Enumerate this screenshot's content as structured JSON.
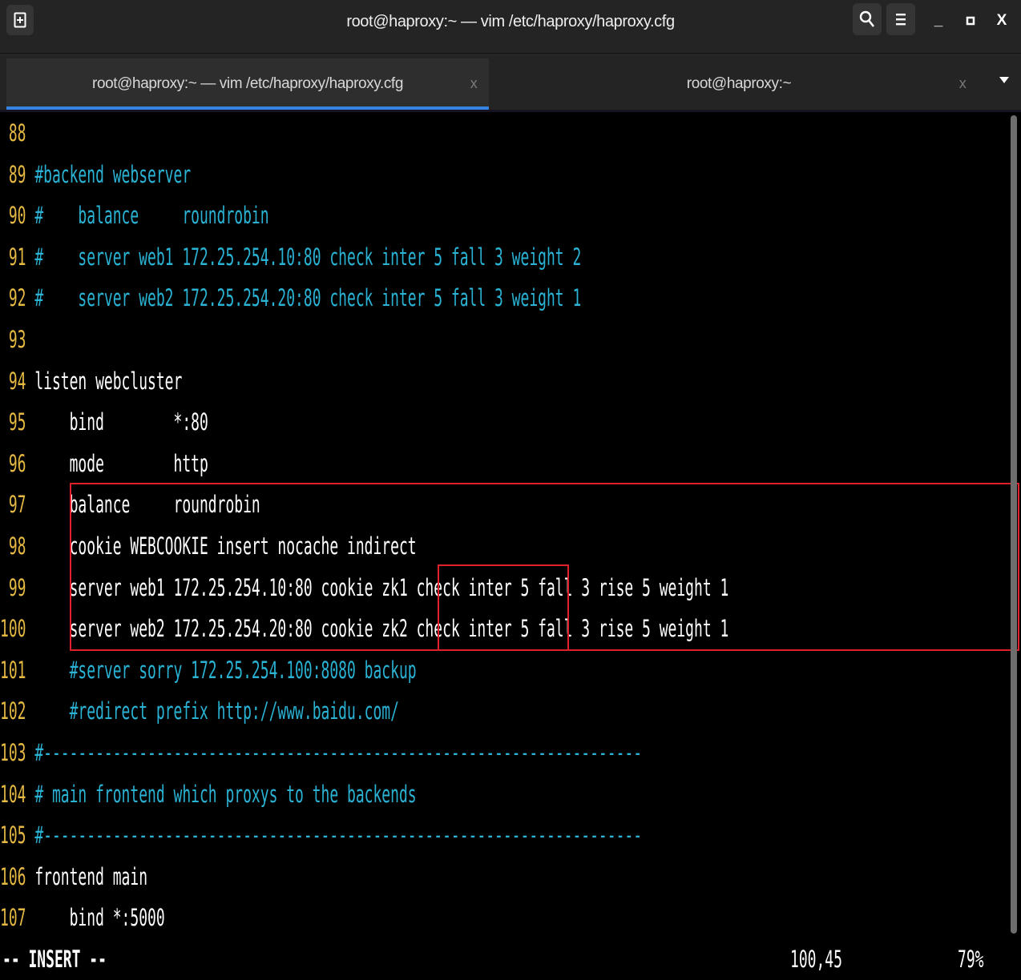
{
  "window": {
    "title": "root@haproxy:~ — vim /etc/haproxy/haproxy.cfg",
    "buttons": {
      "new_tab_icon": "new-tab-icon",
      "search_icon": "search-icon",
      "menu_icon": "hamburger-menu-icon",
      "minimize": "_",
      "maximize": "▫",
      "close": "X"
    }
  },
  "tabs": [
    {
      "label": "root@haproxy:~ — vim /etc/haproxy/haproxy.cfg",
      "close": "x",
      "active": true
    },
    {
      "label": "root@haproxy:~",
      "close": "x",
      "active": false
    }
  ],
  "editor": {
    "lines": [
      {
        "num": " 88",
        "text": "",
        "comment": false
      },
      {
        "num": " 89",
        "text": "#backend webserver",
        "comment": true
      },
      {
        "num": " 90",
        "text": "#    balance     roundrobin",
        "comment": true
      },
      {
        "num": " 91",
        "text": "#    server web1 172.25.254.10:80 check inter 5 fall 3 weight 2",
        "comment": true
      },
      {
        "num": " 92",
        "text": "#    server web2 172.25.254.20:80 check inter 5 fall 3 weight 1",
        "comment": true
      },
      {
        "num": " 93",
        "text": "",
        "comment": false
      },
      {
        "num": " 94",
        "text": "listen webcluster",
        "comment": false
      },
      {
        "num": " 95",
        "text": "    bind        *:80",
        "comment": false
      },
      {
        "num": " 96",
        "text": "    mode        http",
        "comment": false
      },
      {
        "num": " 97",
        "text": "    balance     roundrobin",
        "comment": false
      },
      {
        "num": " 98",
        "text": "    cookie WEBCOOKIE insert nocache indirect",
        "comment": false
      },
      {
        "num": " 99",
        "text": "    server web1 172.25.254.10:80 cookie zk1 check inter 5 fall 3 rise 5 weight 1",
        "comment": false
      },
      {
        "num": "100",
        "text": "    server web2 172.25.254.20:80 cookie zk2 check inter 5 fall 3 rise 5 weight 1",
        "comment": false
      },
      {
        "num": "101",
        "text": "    #server sorry 172.25.254.100:8080 backup",
        "comment": true
      },
      {
        "num": "102",
        "text": "    #redirect prefix http://www.baidu.com/",
        "comment": true
      },
      {
        "num": "103",
        "text": "#---------------------------------------------------------------------",
        "comment": true
      },
      {
        "num": "104",
        "text": "# main frontend which proxys to the backends",
        "comment": true
      },
      {
        "num": "105",
        "text": "#---------------------------------------------------------------------",
        "comment": true
      },
      {
        "num": "106",
        "text": "frontend main",
        "comment": false
      },
      {
        "num": "107",
        "text": "    bind *:5000",
        "comment": false
      }
    ],
    "status": {
      "mode": "-- INSERT --",
      "position": "100,45",
      "percent": "79%"
    }
  },
  "colors": {
    "line_number": "#e5b942",
    "comment": "#2ab3d4",
    "text": "#ffffff",
    "highlight_box": "#e0202a",
    "tab_indicator": "#3584e4"
  }
}
